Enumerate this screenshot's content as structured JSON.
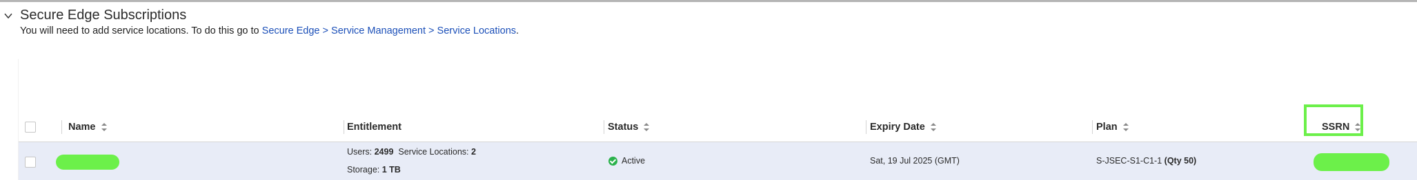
{
  "section": {
    "title": "Secure Edge Subscriptions",
    "desc_prefix": "You will need to add service locations. To do this go to ",
    "desc_link": "Secure Edge > Service Management > Service Locations",
    "desc_suffix": "."
  },
  "table": {
    "columns": [
      "Name",
      "Entitlement",
      "Status",
      "Expiry Date",
      "Plan",
      "SSRN"
    ],
    "rows": [
      {
        "entitlement": {
          "users_label": "Users:",
          "users_value": "2499",
          "locations_label": "Service Locations:",
          "locations_value": "2",
          "storage_label": "Storage:",
          "storage_value": "1 TB"
        },
        "status": "Active",
        "status_color": "#2bb24c",
        "expiry": "Sat, 19 Jul 2025 (GMT)",
        "plan_code": "S-JSEC-S1-C1-1",
        "plan_qty": "(Qty 50)"
      }
    ]
  },
  "colors": {
    "link": "#1b4fb8",
    "row_highlight": "#e8ecf7",
    "redaction": "#6cf04a"
  }
}
